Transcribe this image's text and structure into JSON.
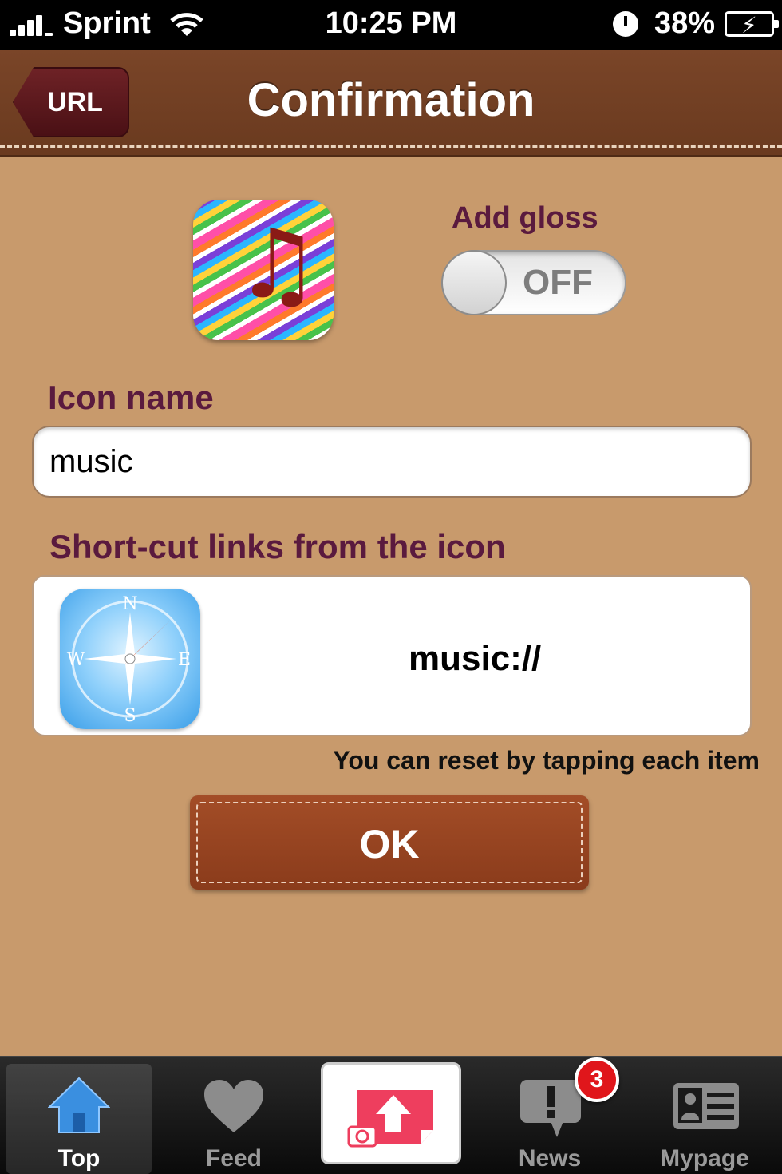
{
  "status_bar": {
    "carrier": "Sprint",
    "time": "10:25 PM",
    "battery": "38%"
  },
  "nav": {
    "back_label": "URL",
    "title": "Confirmation"
  },
  "gloss": {
    "label": "Add gloss",
    "state": "OFF"
  },
  "icon_name": {
    "label": "Icon name",
    "value": "music"
  },
  "shortcut": {
    "label": "Short-cut links from the icon",
    "url": "music://"
  },
  "reset_hint": "You can reset by tapping each item",
  "ok_label": "OK",
  "tabs": [
    {
      "label": "Top",
      "icon": "home-icon",
      "active": true
    },
    {
      "label": "Feed",
      "icon": "heart-icon"
    },
    {
      "label": "",
      "icon": "camera-upload-icon"
    },
    {
      "label": "News",
      "icon": "speech-bubble-icon",
      "badge": "3"
    },
    {
      "label": "Mypage",
      "icon": "profile-card-icon"
    }
  ],
  "colors": {
    "nav_brown": "#6a3a1f",
    "label_purple": "#5a1a3e",
    "ok_button": "#8a3b1b",
    "badge_red": "#e0161b"
  }
}
